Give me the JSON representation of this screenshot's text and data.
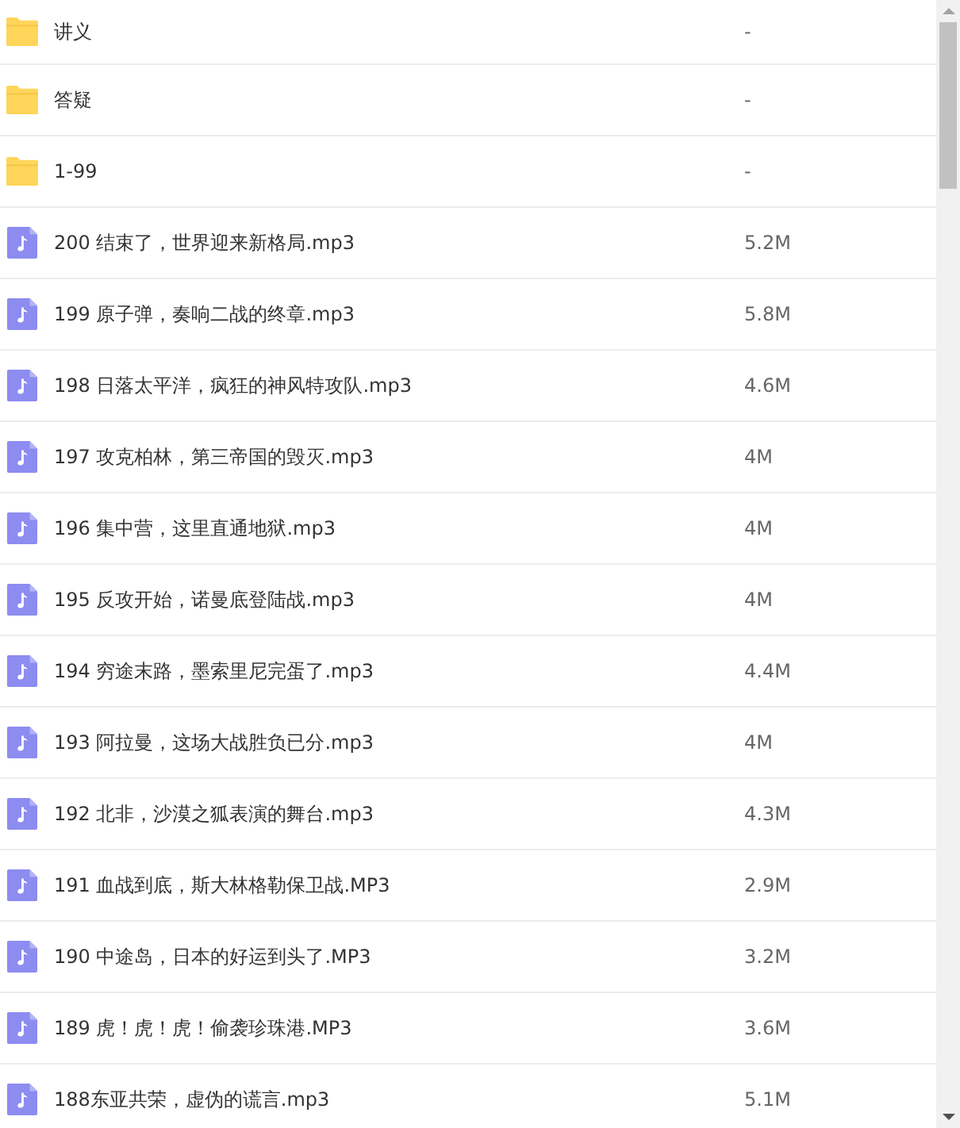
{
  "files": [
    {
      "kind": "folder",
      "name": "讲义",
      "size": "-"
    },
    {
      "kind": "folder",
      "name": "答疑",
      "size": "-"
    },
    {
      "kind": "folder",
      "name": "1-99",
      "size": "-"
    },
    {
      "kind": "audio",
      "name": "200 结束了，世界迎来新格局.mp3",
      "size": "5.2M"
    },
    {
      "kind": "audio",
      "name": "199 原子弹，奏响二战的终章.mp3",
      "size": "5.8M"
    },
    {
      "kind": "audio",
      "name": "198 日落太平洋，疯狂的神风特攻队.mp3",
      "size": "4.6M"
    },
    {
      "kind": "audio",
      "name": "197 攻克柏林，第三帝国的毁灭.mp3",
      "size": "4M"
    },
    {
      "kind": "audio",
      "name": "196 集中营，这里直通地狱.mp3",
      "size": "4M"
    },
    {
      "kind": "audio",
      "name": "195 反攻开始，诺曼底登陆战.mp3",
      "size": "4M"
    },
    {
      "kind": "audio",
      "name": "194 穷途末路，墨索里尼完蛋了.mp3",
      "size": "4.4M"
    },
    {
      "kind": "audio",
      "name": "193 阿拉曼，这场大战胜负已分.mp3",
      "size": "4M"
    },
    {
      "kind": "audio",
      "name": "192 北非，沙漠之狐表演的舞台.mp3",
      "size": "4.3M"
    },
    {
      "kind": "audio",
      "name": "191 血战到底，斯大林格勒保卫战.MP3",
      "size": "2.9M"
    },
    {
      "kind": "audio",
      "name": "190 中途岛，日本的好运到头了.MP3",
      "size": "3.2M"
    },
    {
      "kind": "audio",
      "name": "189 虎！虎！虎！偷袭珍珠港.MP3",
      "size": "3.6M"
    },
    {
      "kind": "audio",
      "name": "188东亚共荣，虚伪的谎言.mp3",
      "size": "5.1M"
    }
  ]
}
